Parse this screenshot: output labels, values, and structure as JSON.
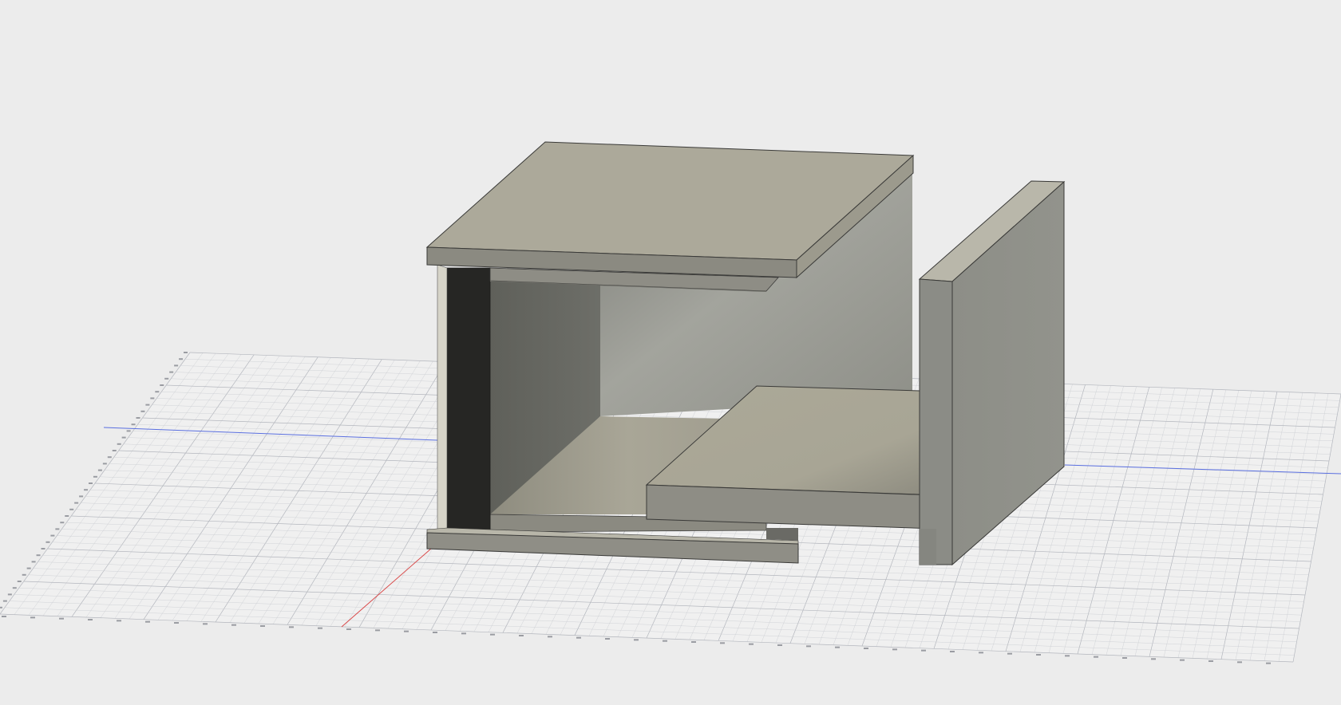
{
  "viewport": {
    "background": "#ececec",
    "grid_color": "#c9cbd0",
    "grid_major_color": "#b3b6bd",
    "x_axis_color": "#d94a4a",
    "y_axis_color": "#5a6fe0"
  },
  "model": {
    "face_top": "#aca99a",
    "face_side": "#8a8b84",
    "face_dark": "#262624",
    "face_shadow": "#6e6f69"
  },
  "labels": {
    "top_tick_count": 40,
    "bottom_tick_count": 45
  }
}
